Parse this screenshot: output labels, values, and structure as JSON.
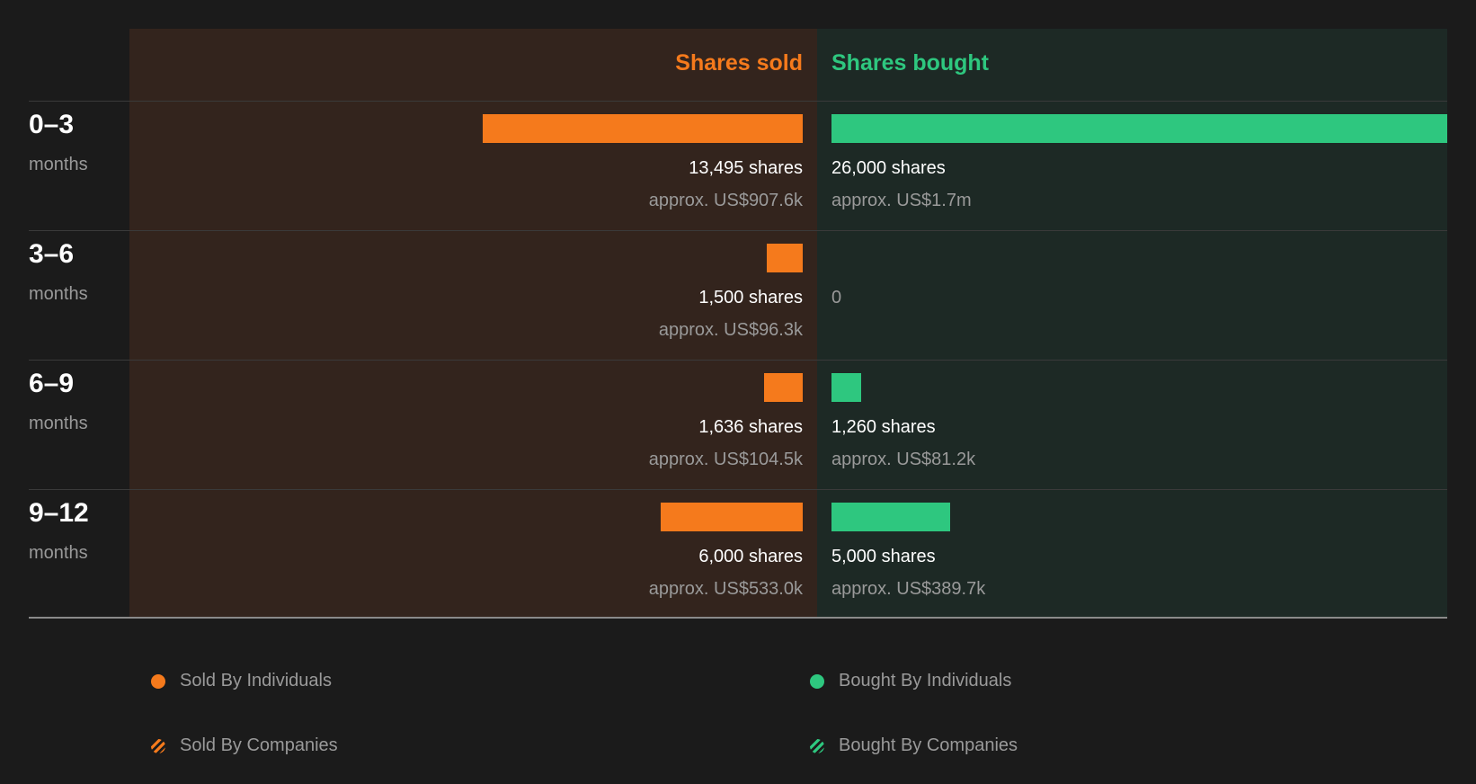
{
  "colors": {
    "sold": "#f57a1c",
    "bought": "#2ec77f",
    "background": "#1b1b1b"
  },
  "headers": {
    "sold": "Shares sold",
    "bought": "Shares bought"
  },
  "chart_data": {
    "type": "bar",
    "categories": [
      "0–3 months",
      "3–6 months",
      "6–9 months",
      "9–12 months"
    ],
    "series": [
      {
        "name": "Shares sold",
        "values": [
          13495,
          1500,
          1636,
          6000
        ]
      },
      {
        "name": "Shares bought",
        "values": [
          26000,
          0,
          1260,
          5000
        ]
      }
    ],
    "rows": [
      {
        "period": "0–3",
        "unit": "months",
        "sold": 13495,
        "bought": 26000,
        "sold_label": "13,495 shares",
        "sold_value": "approx. US$907.6k",
        "bought_label": "26,000 shares",
        "bought_value": "approx. US$1.7m"
      },
      {
        "period": "3–6",
        "unit": "months",
        "sold": 1500,
        "bought": 0,
        "sold_label": "1,500 shares",
        "sold_value": "approx. US$96.3k",
        "bought_label": "0",
        "bought_value": ""
      },
      {
        "period": "6–9",
        "unit": "months",
        "sold": 1636,
        "bought": 1260,
        "sold_label": "1,636 shares",
        "sold_value": "approx. US$104.5k",
        "bought_label": "1,260 shares",
        "bought_value": "approx. US$81.2k"
      },
      {
        "period": "9–12",
        "unit": "months",
        "sold": 6000,
        "bought": 5000,
        "sold_label": "6,000 shares",
        "sold_value": "approx. US$533.0k",
        "bought_label": "5,000 shares",
        "bought_value": "approx. US$389.7k"
      }
    ],
    "scale_max": 26000
  },
  "legend": [
    {
      "label": "Sold By Individuals",
      "icon": "circle-solid-orange"
    },
    {
      "label": "Bought By Individuals",
      "icon": "circle-solid-green"
    },
    {
      "label": "Sold By Companies",
      "icon": "circle-hatched-orange"
    },
    {
      "label": "Bought By Companies",
      "icon": "circle-hatched-green"
    }
  ]
}
